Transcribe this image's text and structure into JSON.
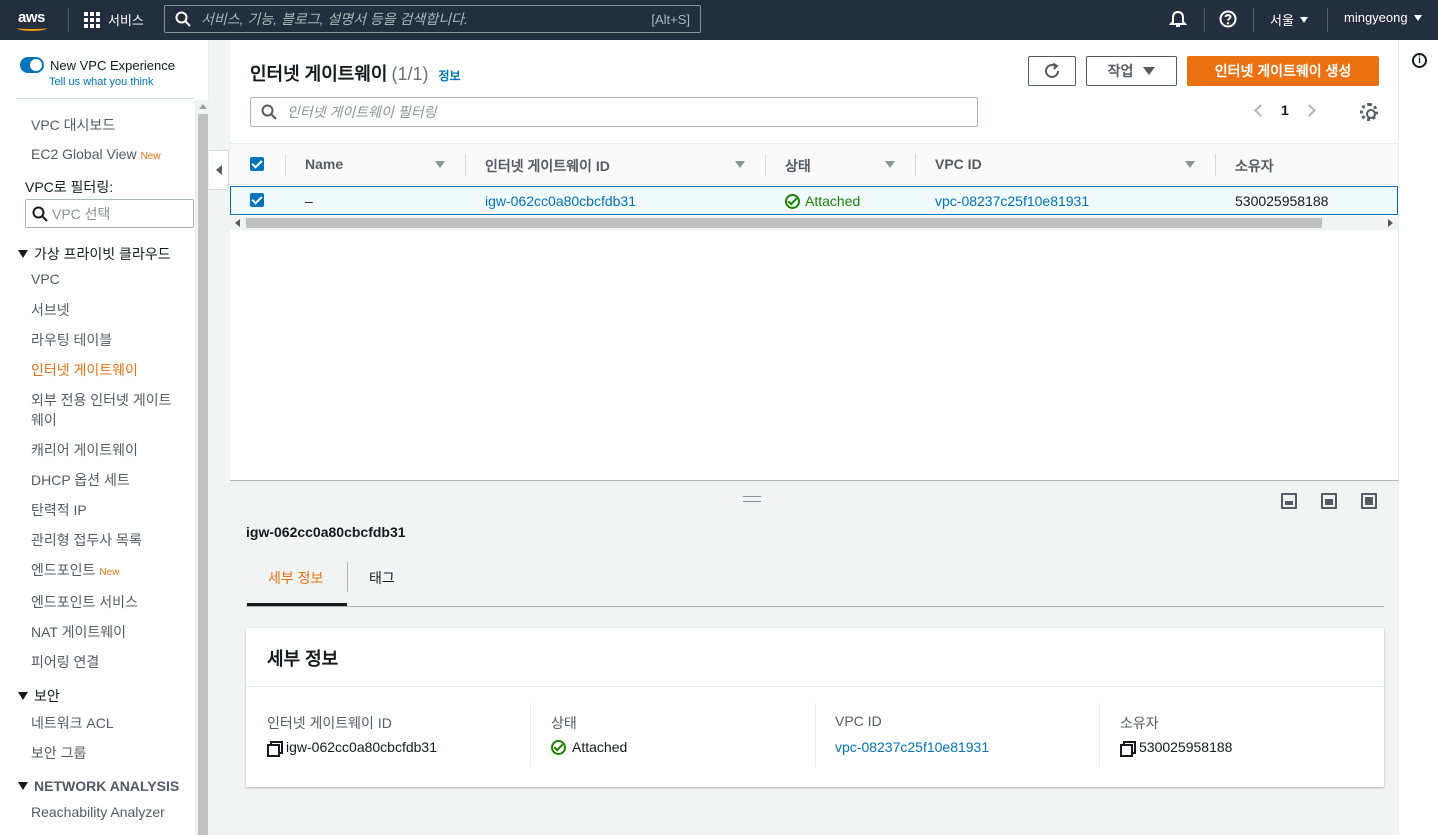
{
  "topnav": {
    "logo_text": "aws",
    "services_label": "서비스",
    "search_placeholder": "서비스, 기능, 블로그, 설명서 등을 검색합니다.",
    "search_shortcut": "[Alt+S]",
    "region": "서울",
    "user": "mingyeong"
  },
  "sidebar": {
    "toggle_label": "New VPC Experience",
    "toggle_sub": "Tell us what you think",
    "items_top": [
      {
        "label": "VPC 대시보드"
      },
      {
        "label": "EC2 Global View",
        "badge": "New"
      }
    ],
    "filter_label": "VPC로 필터링:",
    "filter_placeholder": "VPC 선택",
    "section_vpc": "가상 프라이빗 클라우드",
    "items_vpc": [
      {
        "label": "VPC"
      },
      {
        "label": "서브넷"
      },
      {
        "label": "라우팅 테이블"
      },
      {
        "label": "인터넷 게이트웨이"
      },
      {
        "label": "외부 전용 인터넷 게이트"
      },
      {
        "label": "웨이"
      },
      {
        "label": "캐리어 게이트웨이"
      },
      {
        "label": "DHCP 옵션 세트"
      },
      {
        "label": "탄력적 IP"
      },
      {
        "label": "관리형 접두사 목록"
      },
      {
        "label": "엔드포인트",
        "badge": "New"
      },
      {
        "label": "엔드포인트 서비스"
      },
      {
        "label": "NAT 게이트웨이"
      },
      {
        "label": "피어링 연결"
      }
    ],
    "section_security": "보안",
    "items_security": [
      {
        "label": "네트워크 ACL"
      },
      {
        "label": "보안 그룹"
      }
    ],
    "section_network": "NETWORK ANALYSIS",
    "items_network": [
      {
        "label": "Reachability Analyzer"
      }
    ]
  },
  "main": {
    "title": "인터넷 게이트웨이",
    "count": "(1/1)",
    "info": "정보",
    "actions_label": "작업",
    "create_label": "인터넷 게이트웨이 생성",
    "filter_placeholder": "인터넷 게이트웨이 필터링",
    "page": "1",
    "columns": [
      "Name",
      "인터넷 게이트웨이 ID",
      "상태",
      "VPC ID",
      "소유자"
    ],
    "row": {
      "name": "–",
      "igw_id": "igw-062cc0a80cbcfdb31",
      "state": "Attached",
      "vpc_id": "vpc-08237c25f10e81931",
      "owner": "530025958188"
    }
  },
  "detail": {
    "title": "igw-062cc0a80cbcfdb31",
    "tabs": [
      "세부 정보",
      "태그"
    ],
    "card_title": "세부 정보",
    "fields": [
      {
        "label": "인터넷 게이트웨이 ID",
        "value": "igw-062cc0a80cbcfdb31"
      },
      {
        "label": "상태",
        "value": "Attached"
      },
      {
        "label": "VPC ID",
        "value": "vpc-08237c25f10e81931"
      },
      {
        "label": "소유자",
        "value": "530025958188"
      }
    ]
  },
  "colors": {
    "accent": "#ec7211",
    "link": "#0073bb",
    "success": "#1d8102",
    "nav": "#232f3e"
  }
}
